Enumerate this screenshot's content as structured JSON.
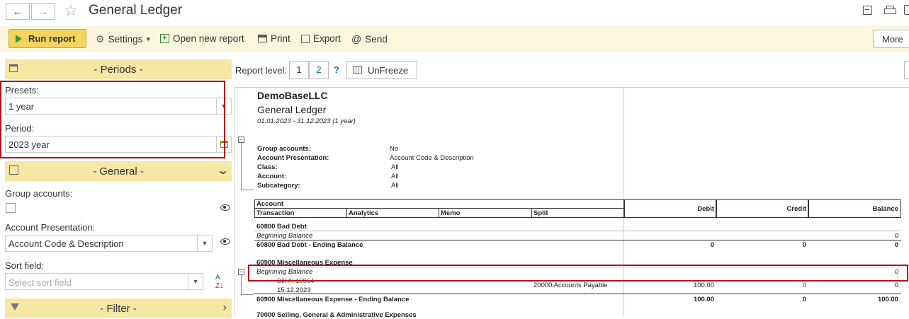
{
  "window": {
    "title": "General Ledger"
  },
  "toolbar": {
    "run_report": "Run report",
    "settings": "Settings",
    "open_new_report": "Open new report",
    "print": "Print",
    "export": "Export",
    "send": "Send",
    "more": "More"
  },
  "report_bar": {
    "report_level_label": "Report level:",
    "level_1": "1",
    "level_2": "2",
    "help": "?",
    "unfreeze": "UnFreeze"
  },
  "sidebar": {
    "periods_header": "- Periods -",
    "presets_label": "Presets:",
    "presets_value": "1 year",
    "period_label": "Period:",
    "period_value": "2023 year",
    "general_header": "- General -",
    "group_accounts_label": "Group accounts:",
    "account_presentation_label": "Account Presentation:",
    "account_presentation_value": "Account Code & Description",
    "sort_field_label": "Sort field:",
    "sort_field_placeholder": "Select sort field",
    "filter_header": "- Filter -"
  },
  "report": {
    "company": "DemoBaseLLC",
    "name": "General Ledger",
    "period": "01.01.2023 - 31.12.2023 (1 year)",
    "params": [
      {
        "label": "Group accounts:",
        "value": "No"
      },
      {
        "label": "Account Presentation:",
        "value": "Account Code & Description"
      },
      {
        "label": "Class:",
        "value": "All"
      },
      {
        "label": "Account:",
        "value": "All"
      },
      {
        "label": "Subcategory:",
        "value": "All"
      }
    ],
    "headers": {
      "account": "Account",
      "transaction": "Transaction",
      "analytics": "Analytics",
      "memo": "Memo",
      "split": "Split",
      "debit": "Debit",
      "credit": "Credit",
      "balance": "Balance"
    },
    "rows": {
      "acc1_title": "60800 Bad Debt",
      "acc1_beg": "Beginning Balance",
      "acc1_beg_bal": "0",
      "acc1_end": "60800 Bad Debt - Ending Balance",
      "acc1_end_debit": "0",
      "acc1_end_credit": "0",
      "acc1_end_balance": "0",
      "acc2_title": "60900 Miscellaneous Expense",
      "acc2_beg": "Beginning Balance",
      "acc2_beg_bal": "0",
      "tx_doc": "Bill #: 10064",
      "tx_date": "15.12.2023",
      "tx_split": "20000 Accounts Payable",
      "tx_debit": "100.00",
      "tx_credit": "0",
      "tx_balance": "0",
      "acc2_end": "60900 Miscellaneous Expense - Ending Balance",
      "acc2_end_debit": "100.00",
      "acc2_end_credit": "0",
      "acc2_end_balance": "100.00",
      "acc3_title_partial": "70000 Selling, General & Administrative Expenses"
    },
    "collapse_symbol": "−"
  }
}
